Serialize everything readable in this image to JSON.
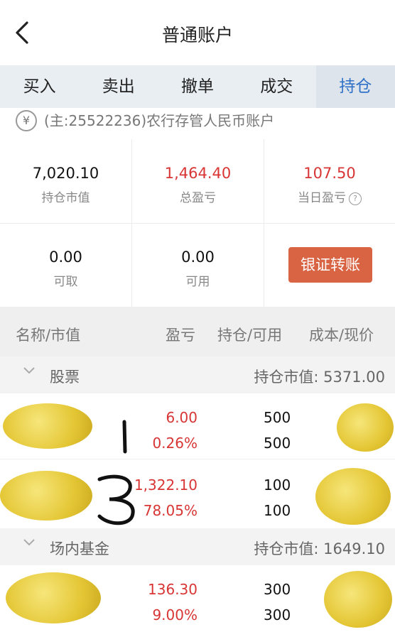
{
  "header": {
    "title": "普通账户"
  },
  "tabs": [
    {
      "label": "买入"
    },
    {
      "label": "卖出"
    },
    {
      "label": "撤单"
    },
    {
      "label": "成交"
    },
    {
      "label": "持仓"
    }
  ],
  "account": {
    "currency_symbol": "¥",
    "text": "(主:25522236)农行存管人民币账户"
  },
  "summary": {
    "market_value": {
      "value": "7,020.10",
      "label": "持仓市值"
    },
    "total_pl": {
      "value": "1,464.40",
      "label": "总盈亏"
    },
    "today_pl": {
      "value": "107.50",
      "label": "当日盈亏"
    },
    "withdrawable": {
      "value": "0.00",
      "label": "可取"
    },
    "available": {
      "value": "0.00",
      "label": "可用"
    },
    "transfer_button": "银证转账",
    "help_symbol": "?"
  },
  "list_header": {
    "name": "名称/市值",
    "pl": "盈亏",
    "position": "持仓/可用",
    "cost": "成本/现价"
  },
  "groups": [
    {
      "name": "股票",
      "market_value": "持仓市值: 5371.00",
      "rows": [
        {
          "pl": "6.00",
          "pl_pct": "0.26%",
          "position": "500",
          "available": "500"
        },
        {
          "pl": "1,322.10",
          "pl_pct": "78.05%",
          "position": "100",
          "available": "100"
        }
      ]
    },
    {
      "name": "场内基金",
      "market_value": "持仓市值: 1649.10",
      "rows": [
        {
          "pl": "136.30",
          "pl_pct": "9.00%",
          "position": "300",
          "available": "300"
        }
      ]
    }
  ],
  "annotations": [
    "1",
    "3"
  ]
}
